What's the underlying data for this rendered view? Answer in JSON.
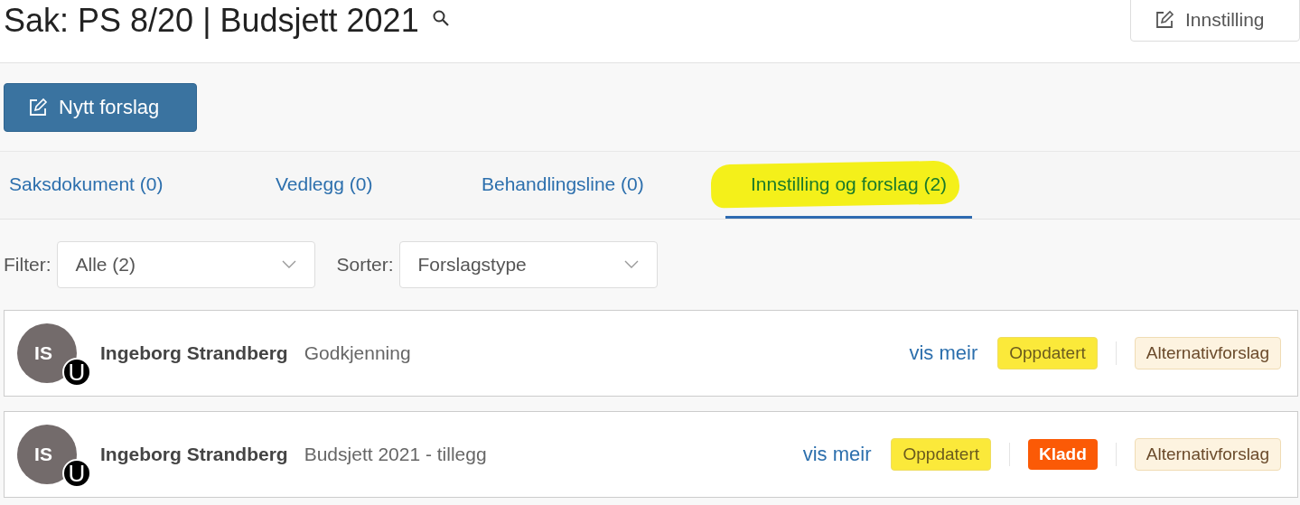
{
  "title": "Sak: PS 8/20 | Budsjett 2021",
  "settings_button": "Innstilling",
  "new_button": "Nytt forslag",
  "tabs": [
    {
      "label": "Saksdokument (0)",
      "selected": false,
      "highlighted": false
    },
    {
      "label": "Vedlegg (0)",
      "selected": false,
      "highlighted": false
    },
    {
      "label": "Behandlingsline (0)",
      "selected": false,
      "highlighted": false
    },
    {
      "label": "Innstilling og forslag (2)",
      "selected": true,
      "highlighted": true
    }
  ],
  "filters": [
    {
      "label": "Filter:",
      "value": "Alle (2)"
    },
    {
      "label": "Sorter:",
      "value": "Forslagstype"
    }
  ],
  "proposals": [
    {
      "initials": "IS",
      "badge": "U",
      "author": "Ingeborg Strandberg",
      "title": "Godkjenning",
      "link": "vis meir",
      "tags": [
        {
          "kind": "status",
          "label": "Oppdatert"
        },
        {
          "kind": "type",
          "label": "Alternativforslag"
        }
      ]
    },
    {
      "initials": "IS",
      "badge": "U",
      "author": "Ingeborg Strandberg",
      "title": "Budsjett 2021 - tillegg",
      "link": "vis meir",
      "tags": [
        {
          "kind": "status",
          "label": "Oppdatert"
        },
        {
          "kind": "draft",
          "label": "Kladd"
        },
        {
          "kind": "type",
          "label": "Alternativforslag"
        }
      ]
    }
  ]
}
